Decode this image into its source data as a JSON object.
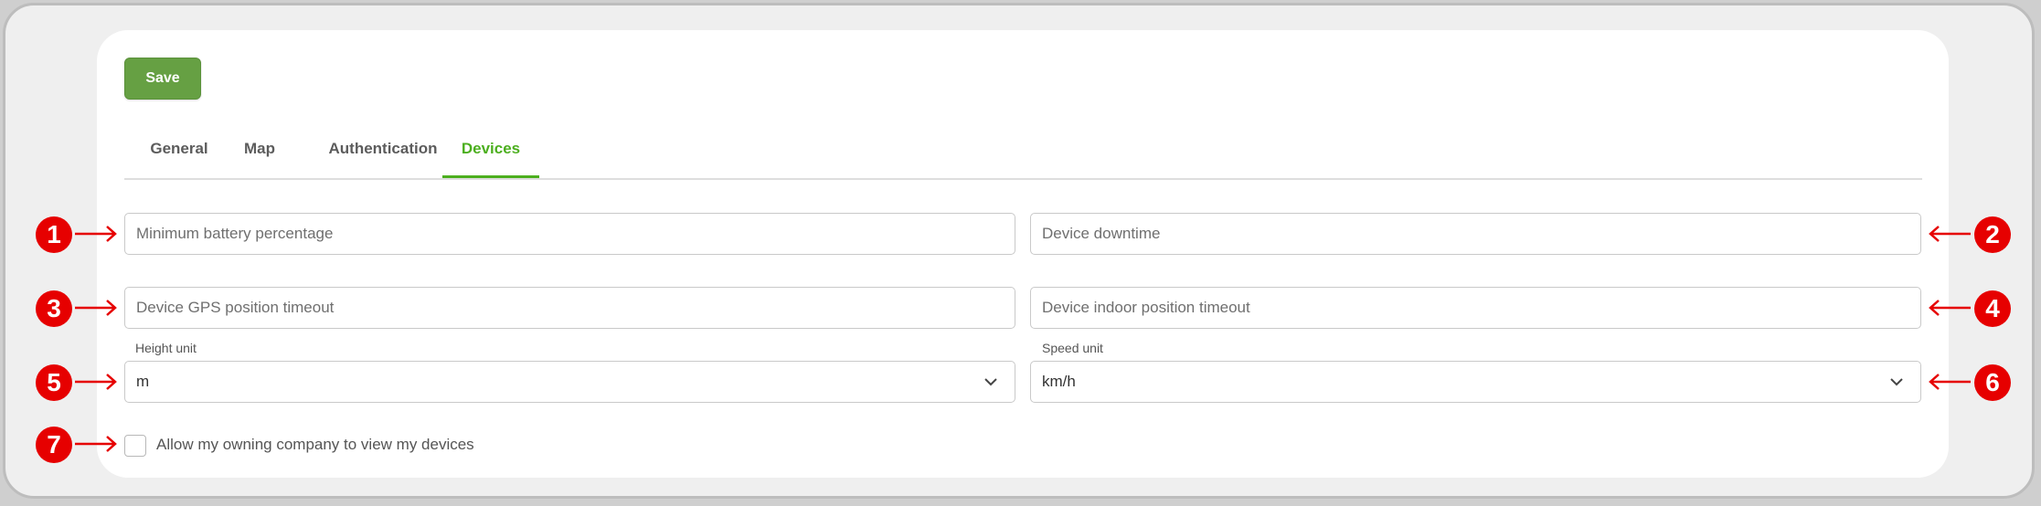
{
  "toolbar": {
    "save_label": "Save"
  },
  "tabs": [
    {
      "label": "General"
    },
    {
      "label": "Map"
    },
    {
      "label": "Authentication"
    },
    {
      "label": "Devices",
      "active": true
    }
  ],
  "fields": {
    "min_battery": {
      "placeholder": "Minimum battery percentage"
    },
    "device_downtime": {
      "placeholder": "Device downtime"
    },
    "gps_timeout": {
      "placeholder": "Device GPS position timeout"
    },
    "indoor_timeout": {
      "placeholder": "Device indoor position timeout"
    },
    "height_unit": {
      "label": "Height unit",
      "value": "m"
    },
    "speed_unit": {
      "label": "Speed unit",
      "value": "km/h"
    }
  },
  "checkbox": {
    "label": "Allow my owning company to view my devices",
    "checked": false
  },
  "annotations": [
    "1",
    "2",
    "3",
    "4",
    "5",
    "6",
    "7"
  ],
  "colors": {
    "accent": "#4caf1f",
    "save": "#66a043",
    "annotation": "#e60000"
  },
  "icons": {
    "select_chevron": "chevron-down-icon",
    "annotation_arrow": "arrow-icon"
  }
}
